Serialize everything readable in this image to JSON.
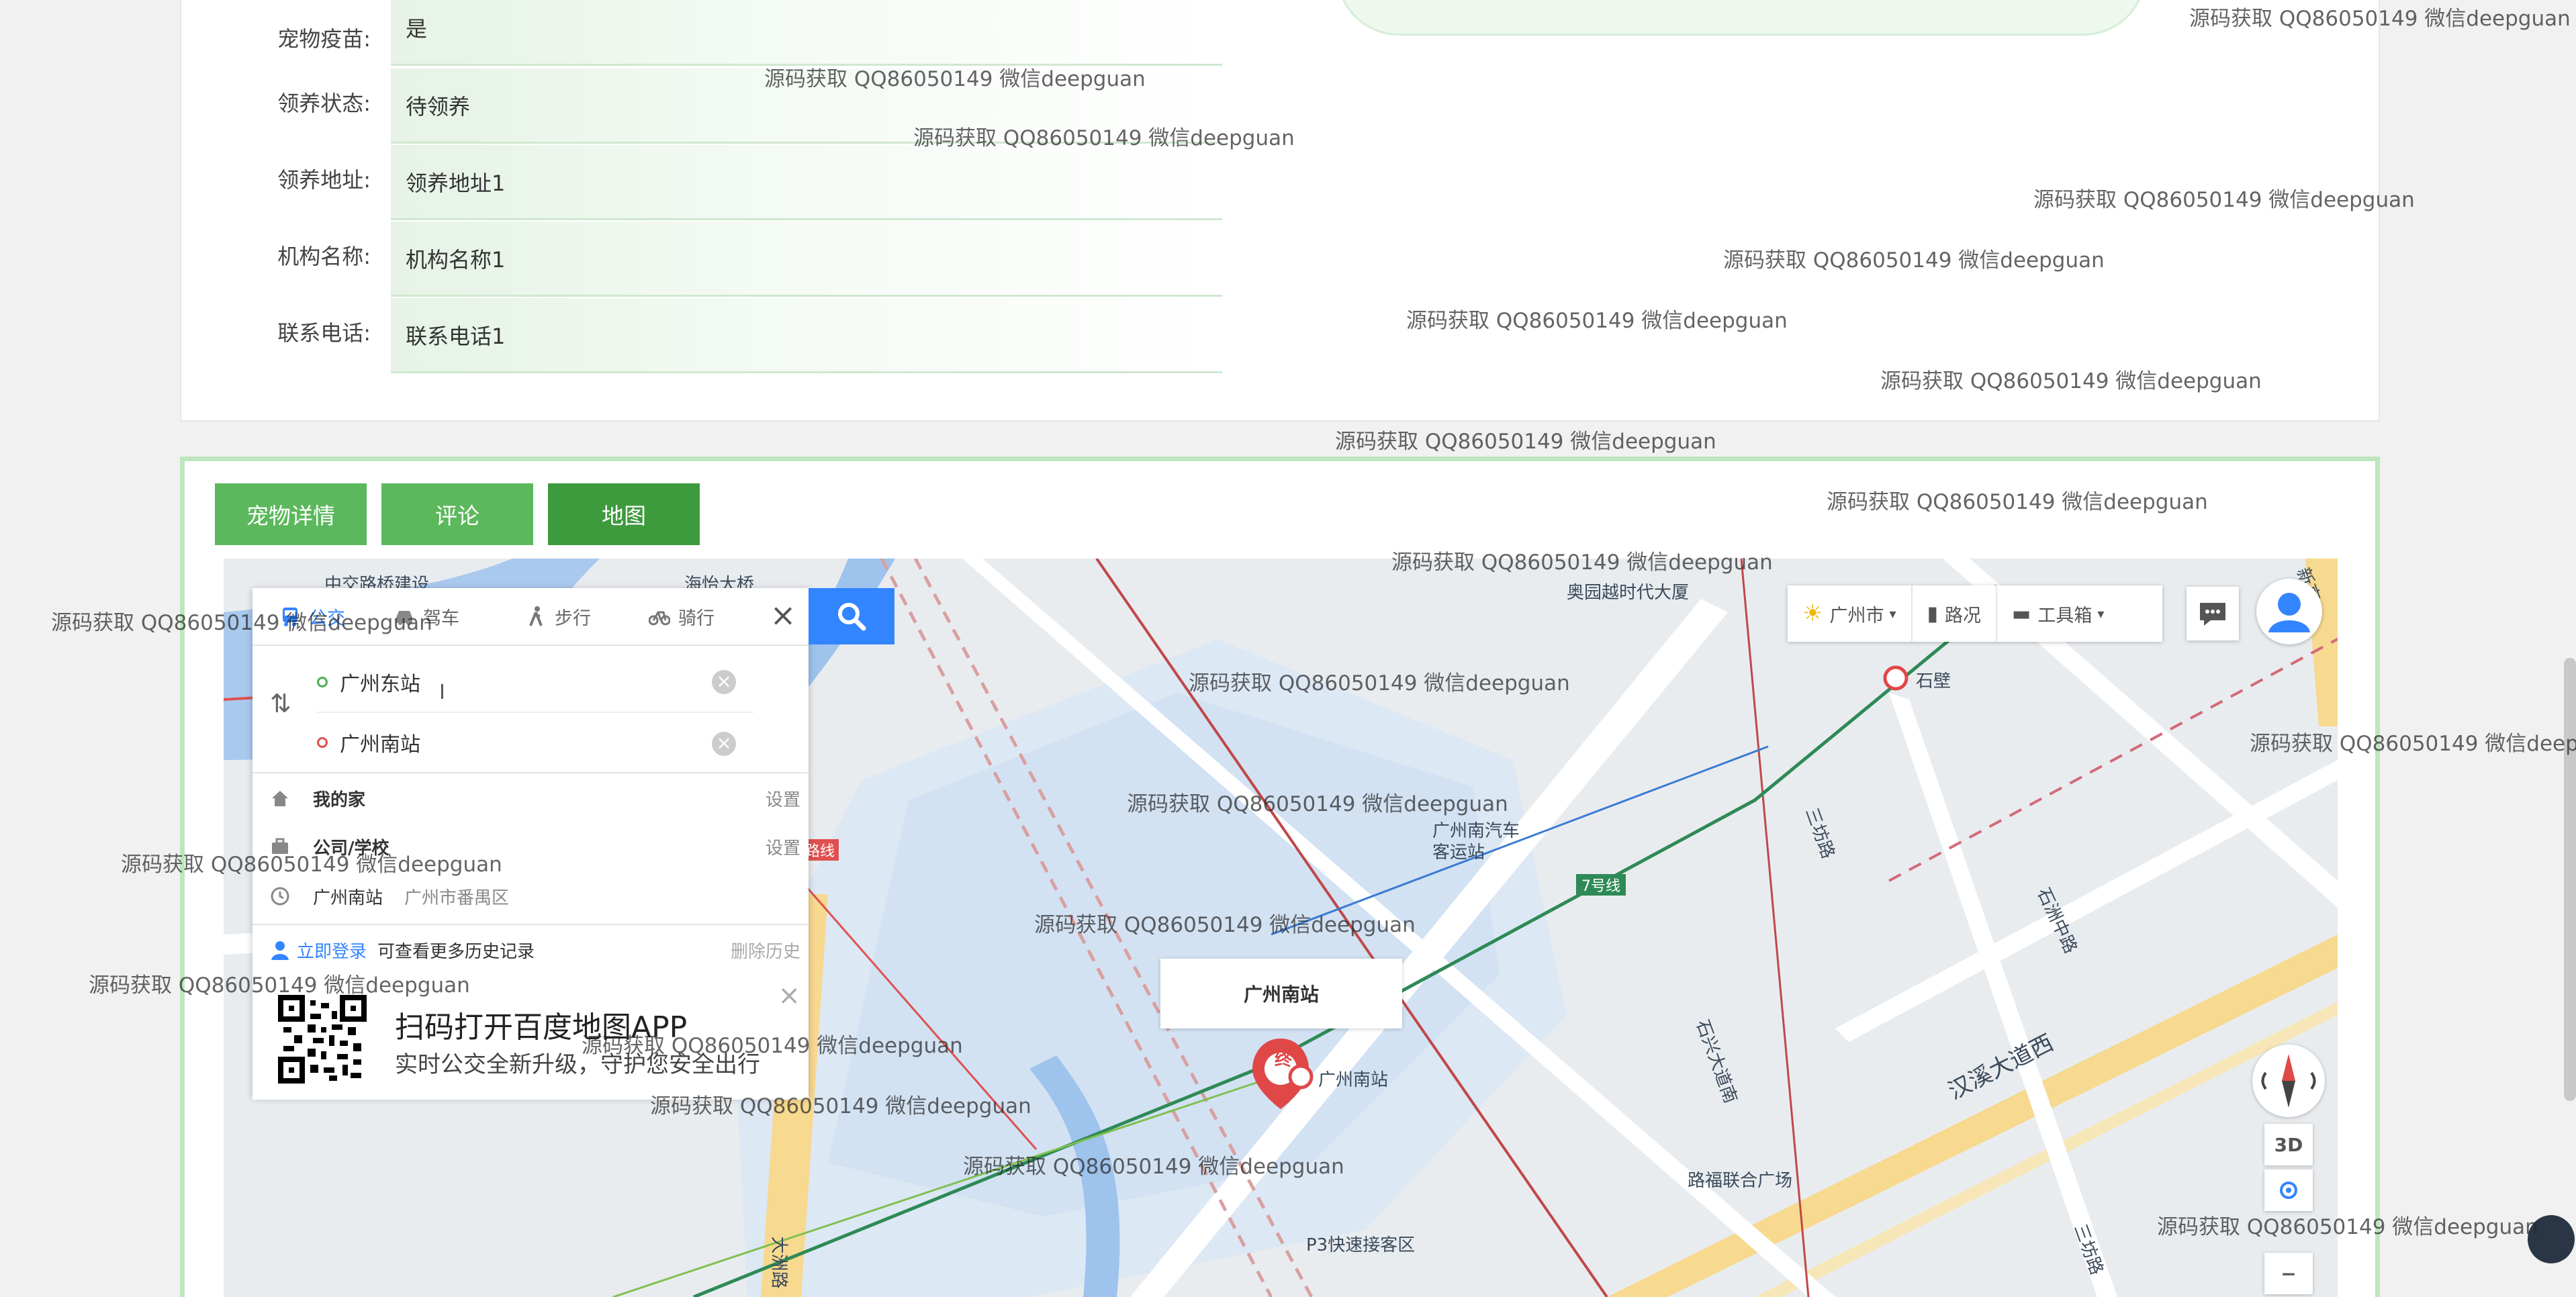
{
  "pet_detail": {
    "rows": [
      {
        "label": "宠物疫苗:",
        "value": "是"
      },
      {
        "label": "领养状态:",
        "value": "待领养"
      },
      {
        "label": "领养地址:",
        "value": "领养地址1"
      },
      {
        "label": "机构名称:",
        "value": "机构名称1"
      },
      {
        "label": "联系电话:",
        "value": "联系电话1"
      }
    ]
  },
  "tabs": [
    {
      "label": "宠物详情",
      "active": false
    },
    {
      "label": "评论",
      "active": false
    },
    {
      "label": "地图",
      "active": true
    }
  ],
  "map": {
    "route_panel": {
      "modes": [
        "公交",
        "驾车",
        "步行",
        "骑行"
      ],
      "start": "广州东站",
      "end": "广州南站",
      "home_label": "我的家",
      "home_action": "设置",
      "work_label": "公司/学校",
      "work_action": "设置",
      "history_place": "广州南站",
      "history_district": "广州市番禺区",
      "login_link": "立即登录",
      "login_hint": "可查看更多历史记录",
      "clear_history": "删除历史"
    },
    "qr_promo": {
      "title": "扫码打开百度地图APP",
      "subtitle": "实时公交全新升级，守护您安全出行"
    },
    "toolbar": {
      "city": "广州市",
      "traffic": "路况",
      "tools": "工具箱"
    },
    "controls": {
      "three_d": "3D",
      "zoom_out": "−"
    },
    "popup_title": "广州南站",
    "marker_label": "终",
    "labels": {
      "guangzhou_south": "广州南站",
      "bus_station": "广州南汽车客运站",
      "aoyuan": "奥园越时代大厦",
      "shibi": "石壁",
      "line7": "7号线",
      "line_partial": "路线",
      "sanfang": "三坊路",
      "shizhou": "石洲中路",
      "hanxi": "汉溪大道西",
      "shixing": "石兴大道南",
      "lufu": "路福联合广场",
      "p3": "P3快速接客区",
      "dazhou": "大洲路",
      "zhongjiao": "中交路桥建设",
      "haiyi": "海怡大桥",
      "sanfang2": "三坊路",
      "xingao": "新高"
    }
  },
  "watermarks": [
    "源码获取 QQ86050149 微信deepguan"
  ],
  "colors": {
    "tab_green": "#5cb85c",
    "tab_active": "#3d9a3d",
    "search_blue": "#3385ff",
    "card_border": "#bfe6bf"
  }
}
